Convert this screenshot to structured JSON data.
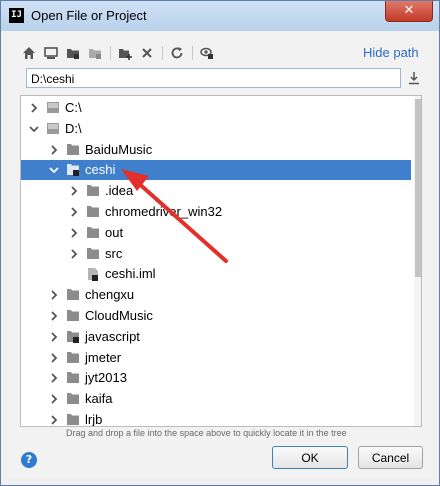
{
  "window": {
    "title": "Open File or Project",
    "app_icon_text": "IJ",
    "close_glyph": "✕"
  },
  "toolbar": {
    "icons": [
      "home-icon",
      "desktop-icon",
      "project-icon",
      "module-icon",
      "new-folder-icon",
      "delete-icon",
      "refresh-icon",
      "show-hidden-icon"
    ],
    "hide_path_label": "Hide path"
  },
  "path_field": {
    "value": "D:\\ceshi"
  },
  "tree": {
    "rows": [
      {
        "label": "C:\\",
        "type": "drive",
        "expanded": false
      },
      {
        "label": "D:\\",
        "type": "drive",
        "expanded": true
      },
      {
        "label": "BaiduMusic",
        "type": "folder",
        "expanded": false
      },
      {
        "label": "ceshi",
        "type": "project-folder",
        "expanded": true,
        "selected": true
      },
      {
        "label": ".idea",
        "type": "folder",
        "expanded": false
      },
      {
        "label": "chromedriver_win32",
        "type": "folder",
        "expanded": false
      },
      {
        "label": "out",
        "type": "folder",
        "expanded": false
      },
      {
        "label": "src",
        "type": "folder",
        "expanded": false
      },
      {
        "label": "ceshi.iml",
        "type": "file"
      },
      {
        "label": "chengxu",
        "type": "folder",
        "expanded": false
      },
      {
        "label": "CloudMusic",
        "type": "folder",
        "expanded": false
      },
      {
        "label": "javascript",
        "type": "project-folder",
        "expanded": false
      },
      {
        "label": "jmeter",
        "type": "folder",
        "expanded": false
      },
      {
        "label": "jyt2013",
        "type": "folder",
        "expanded": false
      },
      {
        "label": "kaifa",
        "type": "folder",
        "expanded": false
      },
      {
        "label": "lrjb",
        "type": "folder",
        "expanded": false
      }
    ]
  },
  "hint_text": "Drag and drop a file into the space above to quickly locate it in the tree",
  "buttons": {
    "help": "?",
    "ok": "OK",
    "cancel": "Cancel"
  },
  "colors": {
    "selection": "#3f7fcb",
    "link": "#2b6cc4",
    "folder": "#8c8c8c",
    "arrow": "#e3302c"
  }
}
